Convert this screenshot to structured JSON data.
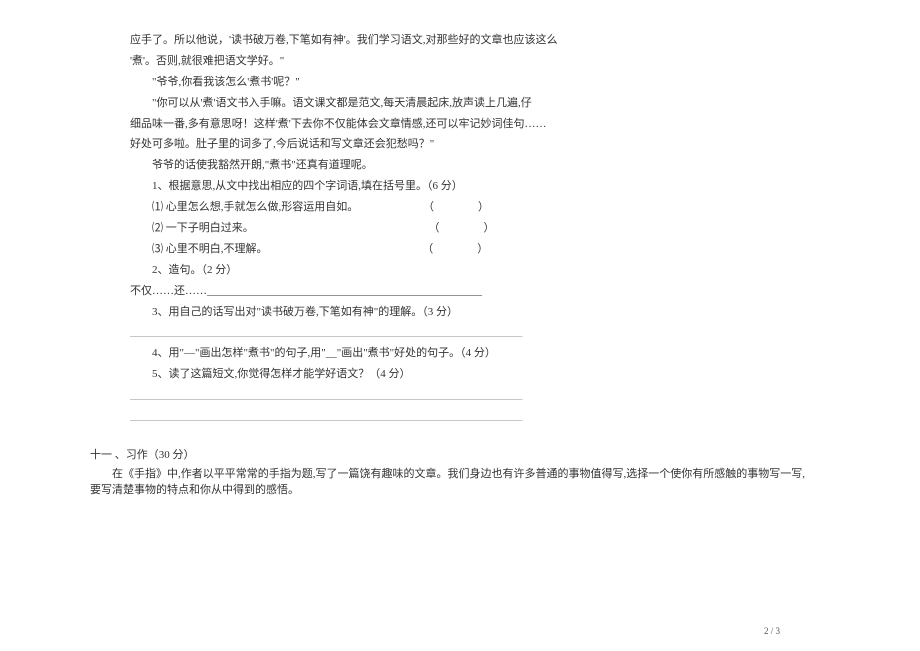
{
  "paragraphs": {
    "p1": "应手了。所以他说，'读书破万卷,下笔如有神'。我们学习语文,对那些好的文章也应该这么",
    "p2": "'煮'。否则,就很难把语文学好。\"",
    "p3": "\"爷爷,你看我该怎么'煮书'呢？\"",
    "p4": "\"你可以从'煮'语文书入手嘛。语文课文都是范文,每天清晨起床,放声读上几遍,仔",
    "p5": "细品味一番,多有意思呀！这样'煮'下去你不仅能体会文章情感,还可以牢记妙词佳句……",
    "p6": "好处可多啦。肚子里的词多了,今后说话和写文章还会犯愁吗？\"",
    "p7": "爷爷的话使我豁然开朗,\"煮书\"还真有道理呢。"
  },
  "questions": {
    "q1": {
      "text": "1、根据意思,从文中找出相应的四个字词语,填在括号里。（6 分）",
      "items": {
        "i1": "⑴ 心里怎么想,手就怎么做,形容运用自如。",
        "i2": "⑵ 一下子明白过来。",
        "i3": "⑶ 心里不明白,不理解。"
      },
      "paren": "（　　　　）"
    },
    "q2": {
      "text": "2、造句。（2 分）",
      "prompt": "不仅……还……"
    },
    "q3": {
      "text": "3、用自己的话写出对\"读书破万卷,下笔如有神\"的理解。（3 分）"
    },
    "q4": {
      "text": "4、用\"—\"画出怎样\"煮书\"的句子,用\"__\"画出\"煮书\"好处的句子。（4 分）"
    },
    "q5": {
      "text": "5、读了这篇短文,你觉得怎样才能学好语文？（4 分）"
    }
  },
  "section11": {
    "title": "十一 、习作（30 分）",
    "content": "　　在《手指》中,作者以平平常常的手指为题,写了一篇饶有趣味的文章。我们身边也有许多普通的事物值得写,选择一个使你有所感触的事物写一写,要写清楚事物的特点和你从中得到的感悟。"
  },
  "lines": {
    "underline_short": "____________________________________________________________",
    "underline_long": "_______________________________________________________________________________________",
    "q2_blank": "__________________________________________________"
  },
  "pageNumber": "2 / 3"
}
